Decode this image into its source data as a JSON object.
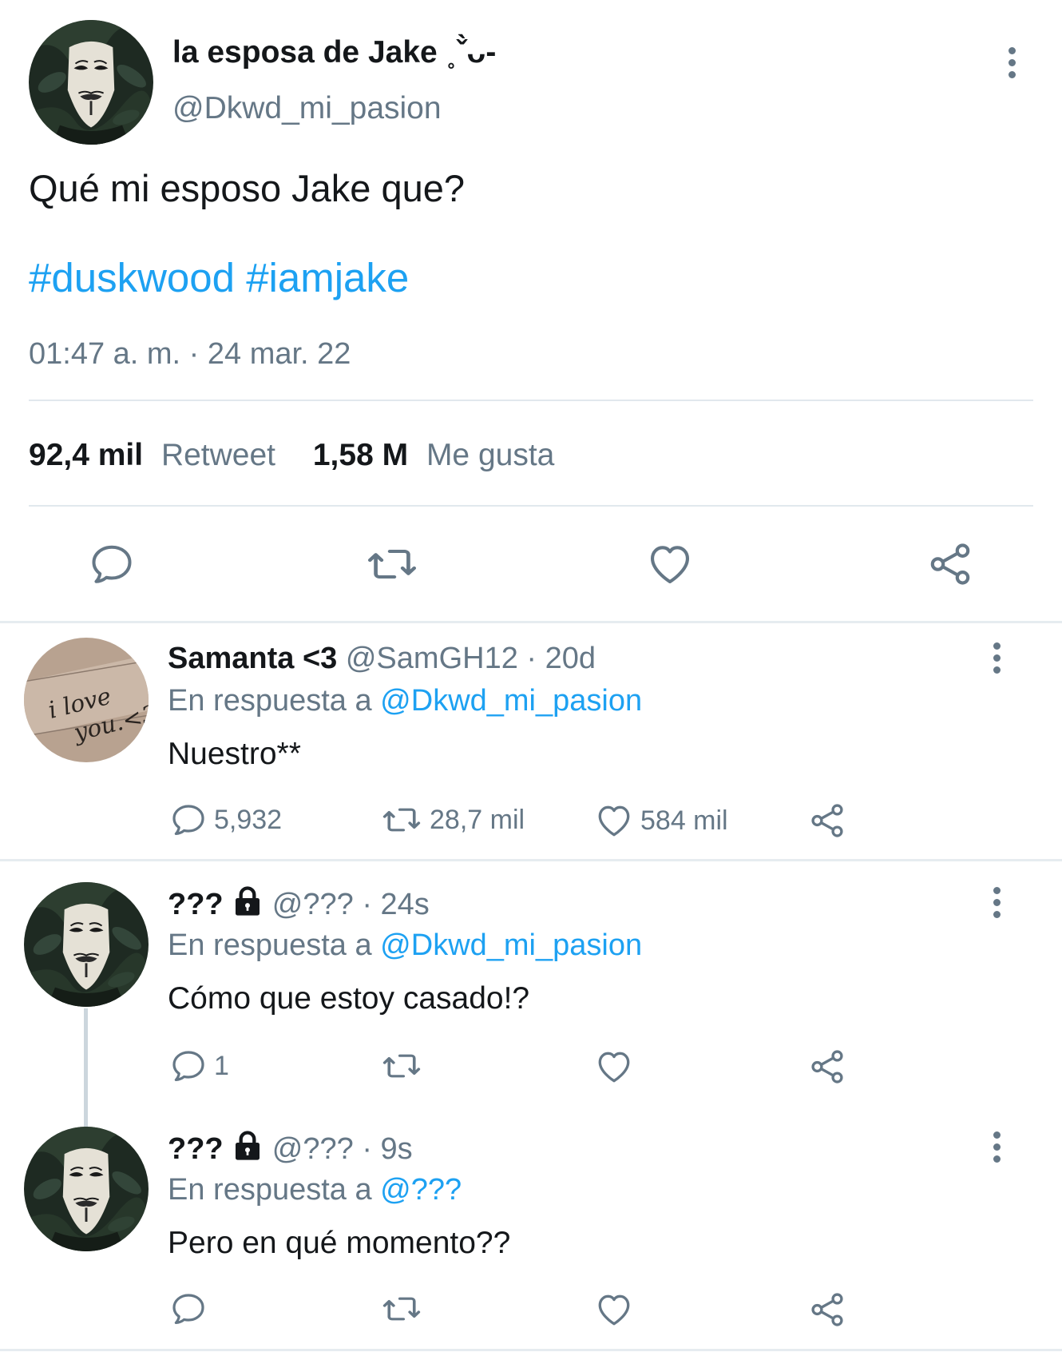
{
  "main_tweet": {
    "display_name": "la esposa de Jake ˳ˇ̀ᴗ-",
    "handle": "@Dkwd_mi_pasion",
    "text": "Qué mi esposo Jake que?",
    "hashtags": [
      "#duskwood",
      "#iamjake"
    ],
    "timestamp": "01:47 a. m. · 24 mar. 22",
    "retweet_count": "92,4 mil",
    "retweet_label": "Retweet",
    "like_count": "1,58 M",
    "like_label": "Me gusta",
    "actions": [
      "reply-icon",
      "retweet-icon",
      "heart-icon",
      "share-icon"
    ]
  },
  "replies": [
    {
      "name": "Samanta <3",
      "handle": "@SamGH12",
      "time": "· 20d",
      "reply_prefix": "En respuesta a",
      "reply_to": "@Dkwd_mi_pasion",
      "text": "Nuestro**",
      "reply_count": "5,932",
      "retweet_count": "28,7 mil",
      "like_count": "584 mil",
      "locked": false
    },
    {
      "name": "???",
      "handle": "@???",
      "time": "· 24s",
      "reply_prefix": "En respuesta a",
      "reply_to": "@Dkwd_mi_pasion",
      "text": "Cómo que estoy casado!?",
      "reply_count": "1",
      "retweet_count": "",
      "like_count": "",
      "locked": true
    },
    {
      "name": "???",
      "handle": "@???",
      "time": "· 9s",
      "reply_prefix": "En respuesta a",
      "reply_to": "@???",
      "text": "Pero en qué momento??",
      "reply_count": "",
      "retweet_count": "",
      "like_count": "",
      "locked": true
    }
  ],
  "colors": {
    "link": "#1da1f2",
    "secondary_text": "#657786",
    "primary_text": "#14171a",
    "divider": "#e1e8ed"
  }
}
